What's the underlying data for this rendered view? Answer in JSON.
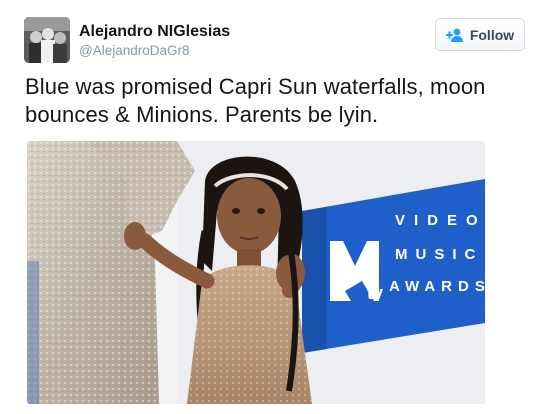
{
  "tweet": {
    "author": {
      "display_name": "Alejandro NIGlesias",
      "handle": "@AlejandroDaGr8",
      "avatar_icon": "profile-photo"
    },
    "follow_button": {
      "label": "Follow",
      "icon": "add-user-icon"
    },
    "text": "Blue was promised Capri Sun waterfalls, moon bounces & Minions. Parents be lyin.",
    "media": {
      "type": "photo",
      "backdrop_words": [
        "VIDEO",
        "MUSIC",
        "AWARDS"
      ],
      "backdrop_logo": "MTV"
    }
  },
  "colors": {
    "backdrop_blue": "#1e5fc9",
    "handle_gray": "#8899a6",
    "follow_text": "#3d4a55",
    "follow_icon": "#1da1f2"
  }
}
